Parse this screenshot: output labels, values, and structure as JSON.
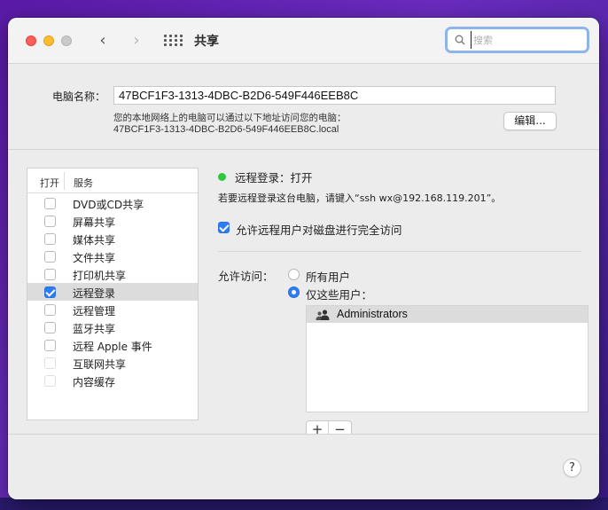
{
  "window": {
    "title": "共享",
    "nav_back": "‹",
    "nav_forward": "›"
  },
  "search": {
    "placeholder": "搜索",
    "value": ""
  },
  "computer": {
    "name_label": "电脑名称：",
    "name_value": "47BCF1F3-1313-4DBC-B2D6-549F446EEB8C",
    "address_description": "您的本地网络上的电脑可以通过以下地址访问您的电脑：",
    "address_value": "47BCF1F3-1313-4DBC-B2D6-549F446EEB8C.local",
    "edit_label": "编辑..."
  },
  "services": {
    "header_on": "打开",
    "header_service": "服务",
    "items": [
      {
        "label": "DVD或CD共享",
        "checked": false,
        "dim": false
      },
      {
        "label": "屏幕共享",
        "checked": false,
        "dim": false
      },
      {
        "label": "媒体共享",
        "checked": false,
        "dim": false
      },
      {
        "label": "文件共享",
        "checked": false,
        "dim": false
      },
      {
        "label": "打印机共享",
        "checked": false,
        "dim": false
      },
      {
        "label": "远程登录",
        "checked": true,
        "dim": false,
        "selected": true
      },
      {
        "label": "远程管理",
        "checked": false,
        "dim": false
      },
      {
        "label": "蓝牙共享",
        "checked": false,
        "dim": false
      },
      {
        "label": "远程 Apple 事件",
        "checked": false,
        "dim": false
      },
      {
        "label": "互联网共享",
        "checked": false,
        "dim": true
      },
      {
        "label": "内容缓存",
        "checked": false,
        "dim": true
      }
    ]
  },
  "detail": {
    "status": "远程登录：打开",
    "status_color": "#2bc840",
    "hint": "若要远程登录这台电脑，请键入“ssh wx@192.168.119.201”。",
    "full_access_label": "允许远程用户对磁盘进行完全访问",
    "full_access_checked": true,
    "allow_label": "允许访问：",
    "radio_all": "所有用户",
    "radio_only": "仅这些用户：",
    "selected_radio": "only",
    "users": [
      "Administrators"
    ],
    "add_label": "+",
    "remove_label": "−"
  },
  "help_label": "?",
  "accent_color": "#2d7cf6"
}
